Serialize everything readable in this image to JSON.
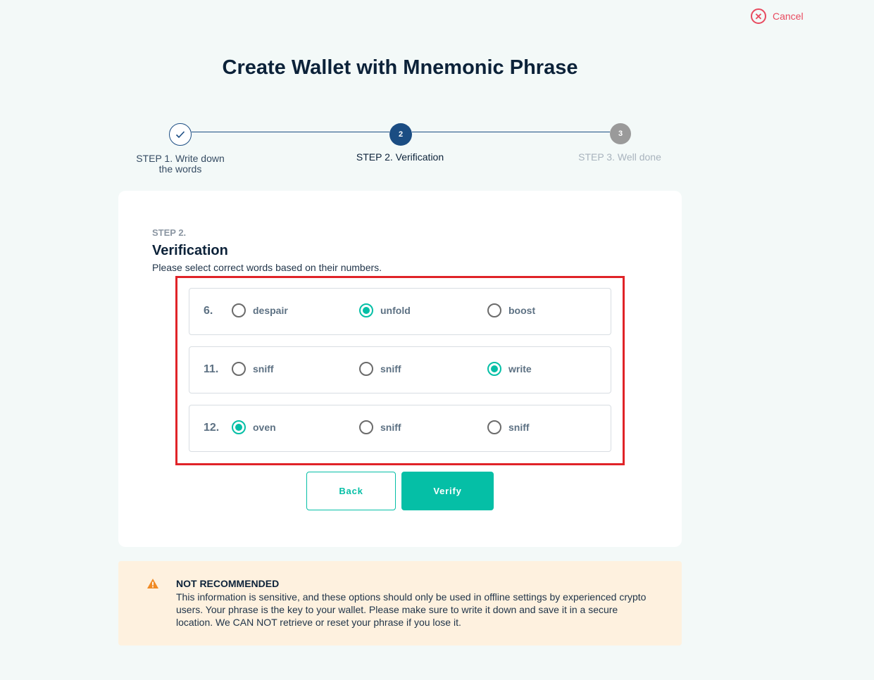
{
  "header": {
    "cancel_label": "Cancel"
  },
  "page_title": "Create Wallet with Mnemonic Phrase",
  "stepper": {
    "steps": [
      {
        "number": "1",
        "label": "STEP 1. Write down the words",
        "state": "done"
      },
      {
        "number": "2",
        "label": "STEP 2. Verification",
        "state": "active"
      },
      {
        "number": "3",
        "label": "STEP 3. Well done",
        "state": "pending"
      }
    ]
  },
  "card": {
    "step_label": "STEP 2.",
    "title": "Verification",
    "description": "Please select correct words based on their numbers.",
    "rows": [
      {
        "number": "6.",
        "options": [
          "despair",
          "unfold",
          "boost"
        ],
        "selected": 1
      },
      {
        "number": "11.",
        "options": [
          "sniff",
          "sniff",
          "write"
        ],
        "selected": 2
      },
      {
        "number": "12.",
        "options": [
          "oven",
          "sniff",
          "sniff"
        ],
        "selected": 0
      }
    ],
    "back_label": "Back",
    "verify_label": "Verify"
  },
  "warning": {
    "title": "NOT RECOMMENDED",
    "text": "This information is sensitive, and these options should only be used in offline settings by experienced crypto users. Your phrase is the key to your wallet. Please make sure to write it down and save it in a secure location. We CAN NOT retrieve or reset your phrase if you lose it."
  },
  "colors": {
    "accent": "#05bfa6",
    "primary": "#1b4d83",
    "cancel": "#e84a5f",
    "highlight": "#e02328",
    "warning_bg": "#fef1df",
    "warning_icon": "#f08a24"
  }
}
